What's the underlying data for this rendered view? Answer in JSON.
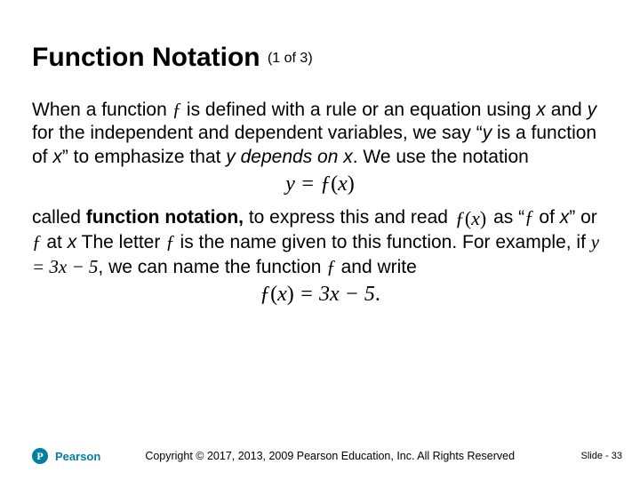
{
  "title": "Function Notation",
  "title_counter": "(1 of 3)",
  "para1_a": "When a function ",
  "f_char": "ƒ",
  "para1_b": " is defined with a rule or an equation using ",
  "x": "x",
  "para1_c": " and ",
  "y": "y",
  "para1_d": " for the independent and dependent variables, we say “",
  "para1_e": " is a function of ",
  "para1_f": "” to emphasize that ",
  "depends_on": " depends on ",
  "para1_g": ".  We use the notation",
  "eq1": "y = ƒ",
  "eq1_paren_l": "(",
  "eq1_x": "x",
  "eq1_paren_r": ")",
  "para2_a": "called ",
  "func_notation": "function notation,",
  "para2_b": " to express this and read ",
  "fx_l": "ƒ",
  "fx_pl": "(",
  "fx_x": "x",
  "fx_pr": ")",
  "para2_c": " as “",
  "of_x": " of ",
  "para2_d": "” or ",
  "at_x": " at ",
  "para2_e": " The letter ",
  "para2_f": " is the name given to this function.  For example, if ",
  "eq_inline": "y = 3x − 5",
  "comma": ",",
  "para2_g": " we can name the function ",
  "para2_h": " and write",
  "eq2_f": "ƒ",
  "eq2_pl": "(",
  "eq2_x": "x",
  "eq2_pr": ")",
  "eq2_rhs": " = 3x − 5",
  "eq2_dot": ".",
  "brand": "Pearson",
  "copyright": "Copyright © 2017, 2013, 2009 Pearson Education, Inc. All Rights Reserved",
  "slide": "Slide - 33"
}
